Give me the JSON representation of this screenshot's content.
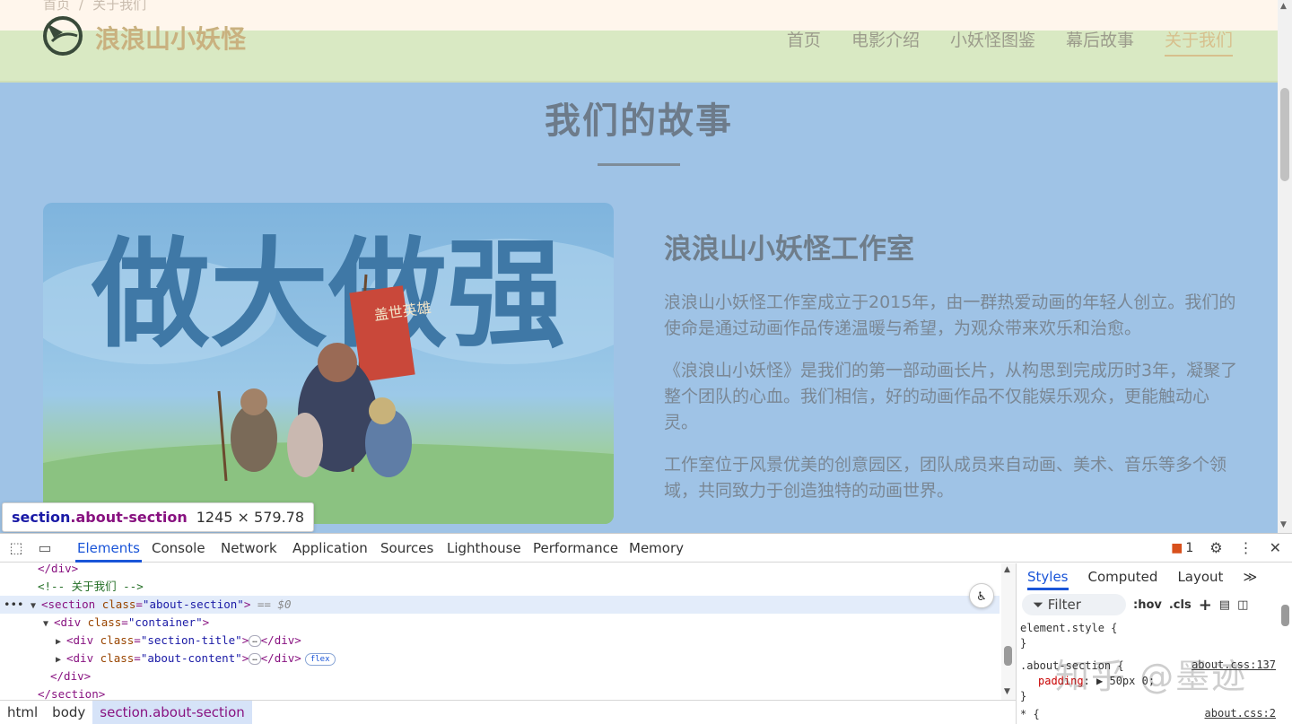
{
  "page": {
    "breadcrumb": [
      "首页",
      "关于我们"
    ],
    "brand": "浪浪山小妖怪",
    "nav": [
      "首页",
      "电影介绍",
      "小妖怪图鉴",
      "幕后故事",
      "关于我们"
    ],
    "nav_active_index": 4,
    "section_title": "我们的故事",
    "image_text": "做大做强",
    "banner_text": "盖世英雄",
    "studio_title": "浪浪山小妖怪工作室",
    "paragraphs": [
      "浪浪山小妖怪工作室成立于2015年，由一群热爱动画的年轻人创立。我们的使命是通过动画作品传递温暖与希望，为观众带来欢乐和治愈。",
      "《浪浪山小妖怪》是我们的第一部动画长片，从构思到完成历时3年，凝聚了整个团队的心血。我们相信，好的动画作品不仅能娱乐观众，更能触动心灵。",
      "工作室位于风景优美的创意园区，团队成员来自动画、美术、音乐等多个领域，共同致力于创造独特的动画世界。"
    ]
  },
  "inspect_tooltip": {
    "tag": "section",
    "class": ".about-section",
    "size": "1245 × 579.78"
  },
  "devtools": {
    "tabs": [
      "Elements",
      "Console",
      "Network",
      "Application",
      "Sources",
      "Lighthouse",
      "Performance",
      "Memory"
    ],
    "active_tab": "Elements",
    "issues_count": "1",
    "dom_lines": {
      "close_div": "</div>",
      "comment": "<!-- 关于我们 -->",
      "section_open_tag": "<section",
      "section_attr": "class",
      "section_val": "\"about-section\"",
      "selected_marker": "== $0",
      "container_val": "\"container\"",
      "title_val": "\"section-title\"",
      "content_val": "\"about-content\"",
      "ellipsis": "…",
      "flex_badge": "flex",
      "close_section": "</section>"
    },
    "breadcrumbs": [
      "html",
      "body",
      "section.about-section"
    ],
    "styles_tabs": [
      "Styles",
      "Computed",
      "Layout"
    ],
    "styles_more": "≫",
    "filter_placeholder": "Filter",
    "hov": ":hov",
    "cls": ".cls",
    "css_rules": {
      "element_style": "element.style {",
      "close_brace": "}",
      "rule2_selector": ".about-section {",
      "rule2_prop": "padding",
      "rule2_value": "▶ 50px 0;",
      "rule2_source": "about.css:137",
      "rule3_selector": "* {",
      "rule3_source": "about.css:2"
    },
    "watermark": "知乎 @墨迹"
  },
  "colors": {
    "accent": "#1a55d8",
    "nav_bg": "#d9e9c3",
    "section_overlay": "#9fc3e6"
  }
}
